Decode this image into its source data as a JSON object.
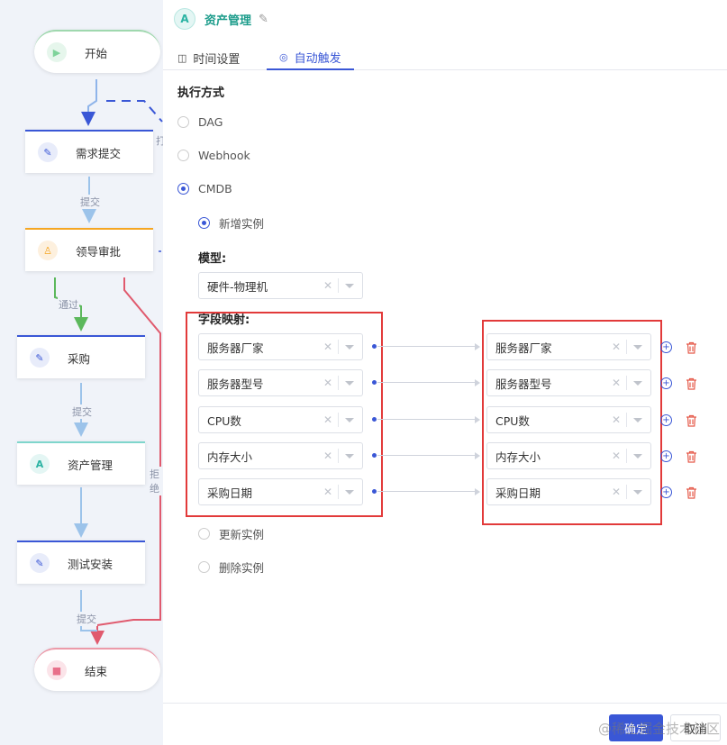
{
  "flow": {
    "nodes": [
      {
        "key": "start",
        "label": "开始",
        "accent": "#7ed39a",
        "icon": "play-icon"
      },
      {
        "key": "request",
        "label": "需求提交",
        "accent": "#3a57d6",
        "icon": "pen-icon"
      },
      {
        "key": "approve",
        "label": "领导审批",
        "accent": "#f5a623",
        "icon": "stamp-icon"
      },
      {
        "key": "purchase",
        "label": "采购",
        "accent": "#3a57d6",
        "icon": "pen-icon"
      },
      {
        "key": "asset",
        "label": "资产管理",
        "accent": "#5ec5bb",
        "icon": "asset-icon"
      },
      {
        "key": "install",
        "label": "测试安装",
        "accent": "#3a57d6",
        "icon": "pen-icon"
      },
      {
        "key": "end",
        "label": "结束",
        "accent": "#e8708a",
        "icon": "stop-icon"
      }
    ],
    "edge_labels": {
      "submit1": "提交",
      "pass": "通过",
      "submit2": "提交",
      "reject": "拒绝",
      "submit3": "提交",
      "partial": "打"
    }
  },
  "panel": {
    "title": "资产管理",
    "title_icon": "A",
    "tabs": [
      {
        "label": "时间设置",
        "icon": "clock-icon",
        "active": false
      },
      {
        "label": "自动触发",
        "icon": "trigger-icon",
        "active": true
      }
    ],
    "exec_section": "执行方式",
    "exec_options": [
      {
        "label": "DAG",
        "checked": false
      },
      {
        "label": "Webhook",
        "checked": false
      },
      {
        "label": "CMDB",
        "checked": true
      }
    ],
    "cmdb_options": [
      {
        "label": "新增实例",
        "checked": true
      },
      {
        "label": "更新实例",
        "checked": false
      },
      {
        "label": "删除实例",
        "checked": false
      }
    ],
    "model_label": "模型:",
    "model_value": "硬件-物理机",
    "mapping_label": "字段映射:",
    "mappings": [
      {
        "source": "服务器厂家",
        "target": "服务器厂家"
      },
      {
        "source": "服务器型号",
        "target": "服务器型号"
      },
      {
        "source": "CPU数",
        "target": "CPU数"
      },
      {
        "source": "内存大小",
        "target": "内存大小"
      },
      {
        "source": "采购日期",
        "target": "采购日期"
      }
    ],
    "confirm_label": "确定",
    "cancel_label": "取消",
    "watermark": "@稀土掘金技术社区"
  },
  "colors": {
    "primary": "#3a57d6",
    "highlight": "#e23a3a",
    "reject": "#e05a6e",
    "pass": "#5cb85c",
    "title": "#1c9c8b"
  }
}
